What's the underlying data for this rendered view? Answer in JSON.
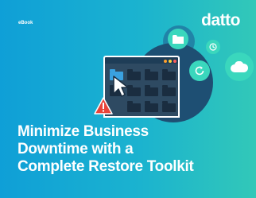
{
  "tag": "eBook",
  "brand": "datto",
  "headline": {
    "line1": "Minimize Business",
    "line2": "Downtime with a",
    "line3": "Complete Restore Toolkit"
  },
  "colors": {
    "background_left": "#0f9fd7",
    "background_right": "#32c8b8",
    "circle": "#1e4f73",
    "bubble": "#3ad7bd",
    "warning": "#e8443a",
    "folder_active": "#3aa1e0"
  },
  "icons": [
    "folder-icon",
    "clock-icon",
    "refresh-icon",
    "cloud-icon",
    "warning-icon",
    "cursor-icon"
  ]
}
